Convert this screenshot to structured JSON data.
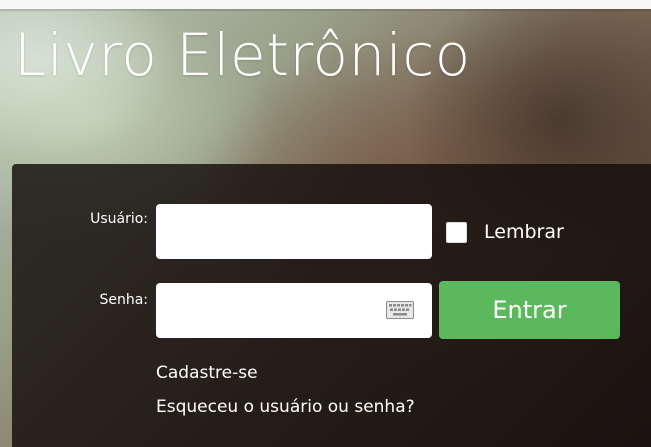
{
  "app": {
    "title": "Livro Eletrônico"
  },
  "login": {
    "username_label": "Usuário:",
    "username_value": "",
    "password_label": "Senha:",
    "password_value": "",
    "remember_label": "Lembrar",
    "remember_checked": false,
    "submit_label": "Entrar",
    "register_link": "Cadastre-se",
    "forgot_link": "Esqueceu o usuário ou senha?",
    "keyboard_icon": "virtual-keyboard-icon"
  },
  "colors": {
    "panel_bg": "#140e0c",
    "button_bg": "#5cb85c",
    "text": "#ffffff"
  }
}
